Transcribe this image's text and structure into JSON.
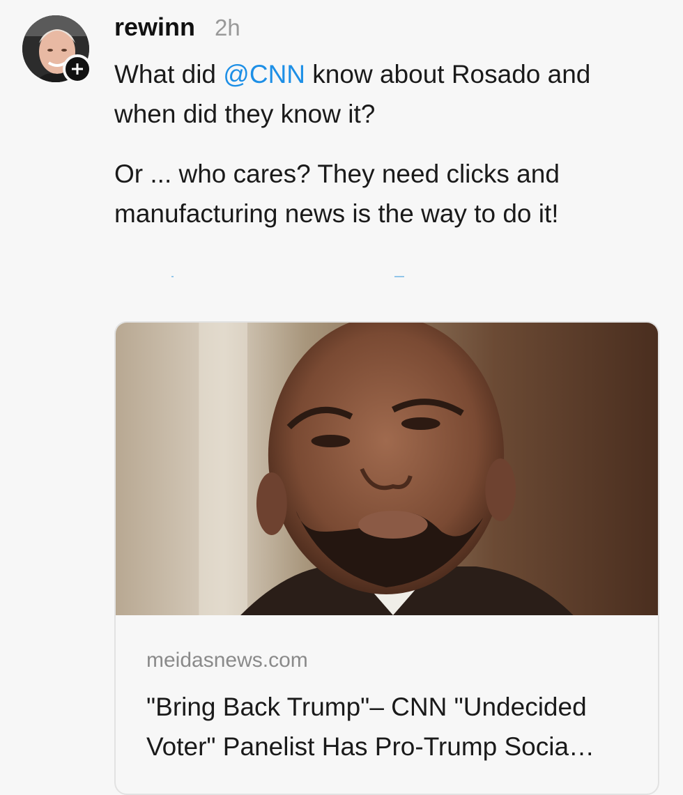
{
  "post": {
    "username": "rewinn",
    "timestamp": "2h",
    "text_before_mention": "What did ",
    "mention": "@CNN",
    "text_after_mention": " know about Rosado and when did they know it?",
    "paragraph_2": "Or ... who cares? They need clicks and manufacturing news is the way to do it!"
  },
  "avatar": {
    "icon": "user-avatar",
    "badge_icon": "plus-icon"
  },
  "link_card": {
    "image": "article-photo",
    "domain": "meidasnews.com",
    "title_line_1": "\"Bring Back Trump\"– CNN \"Undecided",
    "title_line_2": "Voter\" Panelist Has Pro-Trump Socia…"
  },
  "colors": {
    "mention": "#1d8fe6",
    "username": "#111111",
    "timestamp": "#999999",
    "domain": "#8a8a8a",
    "background": "#f7f7f7"
  }
}
